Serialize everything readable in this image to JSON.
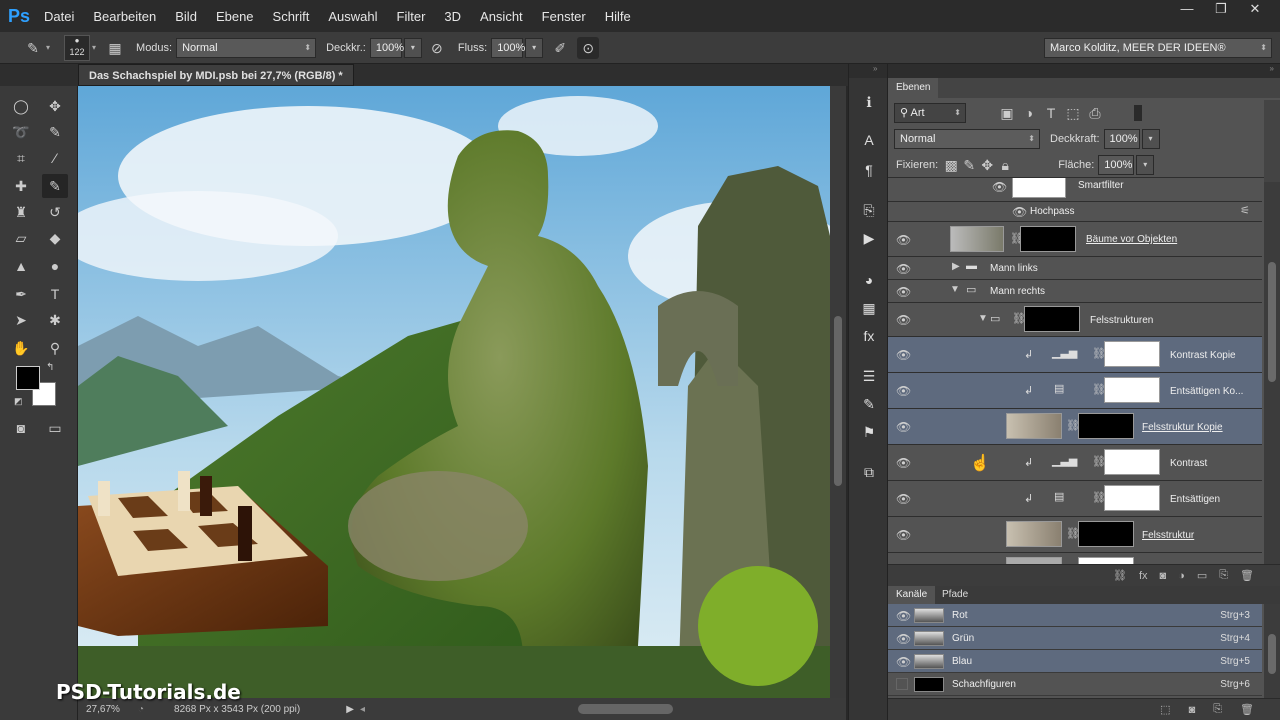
{
  "app": {
    "logo": "Ps"
  },
  "menu": [
    "Datei",
    "Bearbeiten",
    "Bild",
    "Ebene",
    "Schrift",
    "Auswahl",
    "Filter",
    "3D",
    "Ansicht",
    "Fenster",
    "Hilfe"
  ],
  "window_controls": {
    "minimize": "—",
    "restore": "❐",
    "close": "✕"
  },
  "options": {
    "brush_size": "122",
    "modus_label": "Modus:",
    "modus_value": "Normal",
    "deckkr_label": "Deckkr.:",
    "deckkr_value": "100%",
    "fluss_label": "Fluss:",
    "fluss_value": "100%",
    "workspace": "Marco Kolditz, MEER DER IDEEN®"
  },
  "document": {
    "tab_title": "Das Schachspiel by MDI.psb bei 27,7% (RGB/8) *",
    "zoom": "27,67%",
    "size_info": "8268 Px x 3543 Px (200 ppi)"
  },
  "watermark": "PSD-Tutorials.de",
  "layers_panel": {
    "tab": "Ebenen",
    "filter_kind": "Art",
    "blend_mode": "Normal",
    "deckkraft_label": "Deckkraft:",
    "deckkraft_value": "100%",
    "fixieren_label": "Fixieren:",
    "flaeche_label": "Fläche:",
    "flaeche_value": "100%",
    "smartfilter_label": "Smartfilter",
    "hochpass_label": "Hochpass",
    "layers": [
      {
        "name": "Bäume vor Objekten"
      },
      {
        "name": "Mann links"
      },
      {
        "name": "Mann rechts"
      },
      {
        "name": "Felsstrukturen"
      },
      {
        "name": "Kontrast Kopie"
      },
      {
        "name": "Entsättigen Ko..."
      },
      {
        "name": "Felsstruktur Kopie"
      },
      {
        "name": "Kontrast"
      },
      {
        "name": "Entsättigen"
      },
      {
        "name": "Felsstruktur"
      }
    ]
  },
  "channels_panel": {
    "tabs": [
      "Kanäle",
      "Pfade"
    ],
    "channels": [
      {
        "name": "Rot",
        "shortcut": "Strg+3"
      },
      {
        "name": "Grün",
        "shortcut": "Strg+4"
      },
      {
        "name": "Blau",
        "shortcut": "Strg+5"
      },
      {
        "name": "Schachfiguren",
        "shortcut": "Strg+6"
      }
    ]
  }
}
